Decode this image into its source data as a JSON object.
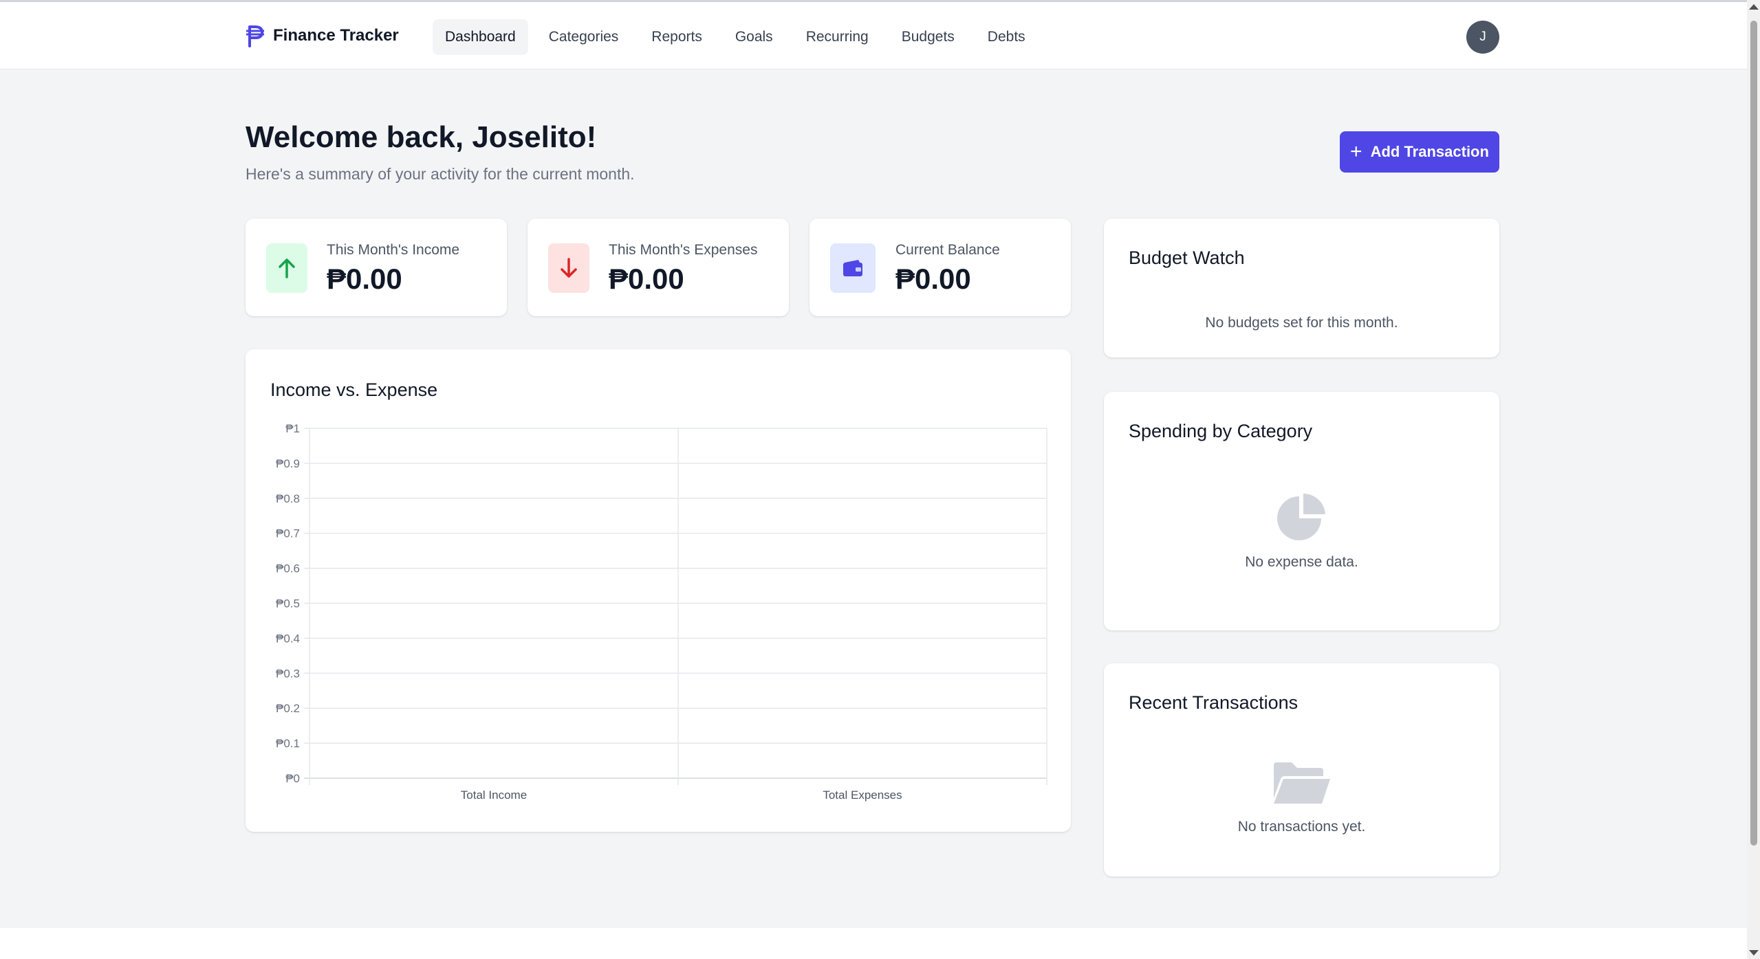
{
  "app": {
    "brand_name": "Finance Tracker",
    "brand_color": "#4f46e5"
  },
  "nav": {
    "items": [
      {
        "label": "Dashboard",
        "active": true
      },
      {
        "label": "Categories"
      },
      {
        "label": "Reports"
      },
      {
        "label": "Goals"
      },
      {
        "label": "Recurring"
      },
      {
        "label": "Budgets"
      },
      {
        "label": "Debts"
      }
    ],
    "avatar_initial": "J"
  },
  "header": {
    "welcome": "Welcome back, Joselito!",
    "subtitle": "Here's a summary of your activity for the current month.",
    "add_button_label": "Add Transaction"
  },
  "stats": {
    "income": {
      "label": "This Month's Income",
      "value": "₱0.00",
      "icon": "arrow-up-icon",
      "color": "#16a34a"
    },
    "expenses": {
      "label": "This Month's Expenses",
      "value": "₱0.00",
      "icon": "arrow-down-icon",
      "color": "#dc2626"
    },
    "balance": {
      "label": "Current Balance",
      "value": "₱0.00",
      "icon": "wallet-icon",
      "color": "#4f46e5"
    }
  },
  "budget_watch": {
    "title": "Budget Watch",
    "empty_text": "No budgets set for this month."
  },
  "spending": {
    "title": "Spending by Category",
    "empty_text": "No expense data.",
    "icon": "pie-chart-icon"
  },
  "recent": {
    "title": "Recent Transactions",
    "empty_text": "No transactions yet.",
    "icon": "folder-open-icon"
  },
  "chart_title": "Income vs. Expense",
  "chart_data": {
    "type": "bar",
    "title": "Income vs. Expense",
    "categories": [
      "Total Income",
      "Total Expenses"
    ],
    "values": [
      0,
      0
    ],
    "xlabel": "",
    "ylabel": "",
    "ylim": [
      0,
      1
    ],
    "yticks": [
      "₱0",
      "₱0.1",
      "₱0.2",
      "₱0.3",
      "₱0.4",
      "₱0.5",
      "₱0.6",
      "₱0.7",
      "₱0.8",
      "₱0.9",
      "₱1"
    ],
    "grid": true
  }
}
